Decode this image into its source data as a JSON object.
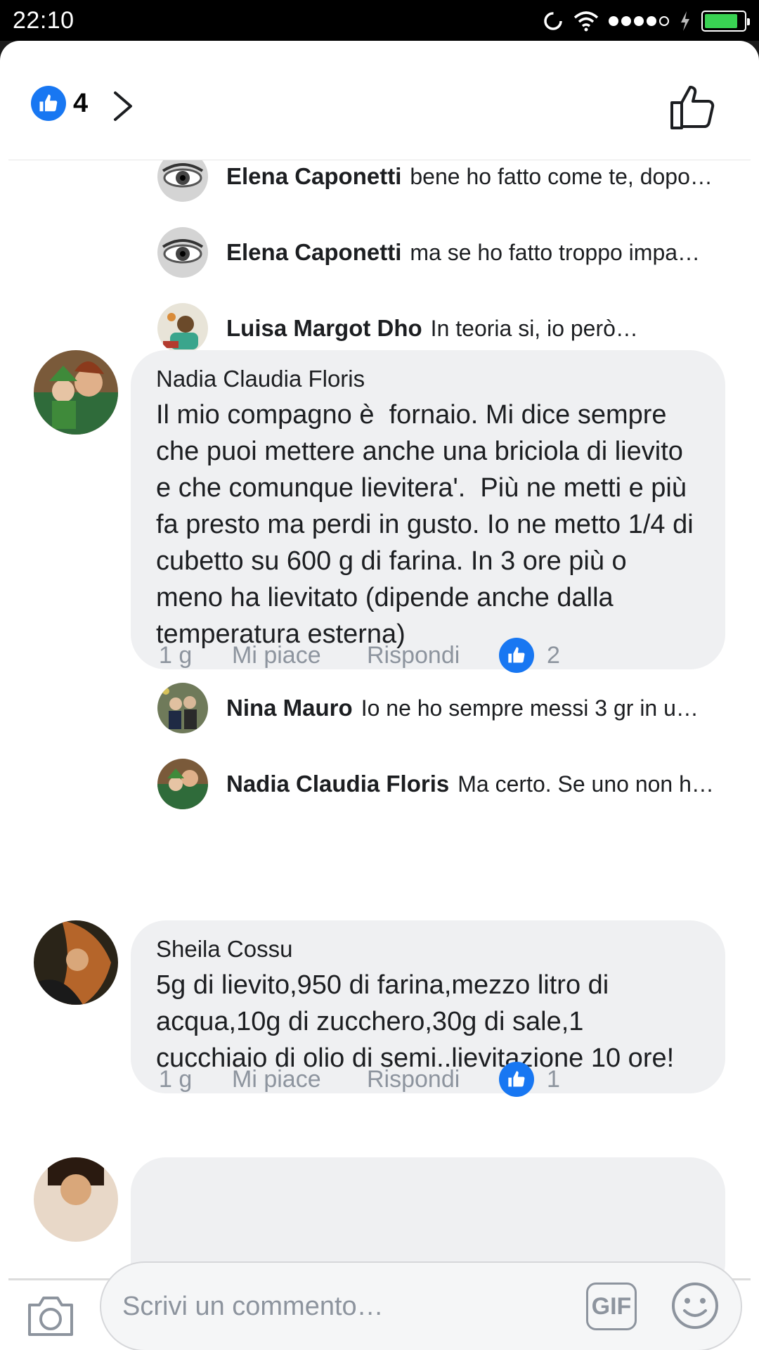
{
  "status_bar": {
    "time": "22:10",
    "battery_level": 0.85,
    "battery_color": "#39d353"
  },
  "header": {
    "reaction_count": "4",
    "accent": "#1877f2"
  },
  "replies_top": [
    {
      "author": "Elena Caponetti",
      "text": "bene ho fatto come te, dopo…"
    },
    {
      "author": "Elena Caponetti",
      "text": "ma se ho fatto troppo impa…"
    },
    {
      "author": "Luisa Margot Dho",
      "text": "In teoria si, io però…"
    }
  ],
  "comment1": {
    "author": "Nadia Claudia Floris",
    "text": "Il mio compagno è  fornaio. Mi dice sempre che puoi mettere anche una briciola di lievito e che comunque lievitera'.  Più ne metti e più fa presto ma perdi in gusto. Io ne metto 1/4 di cubetto su 600 g di farina. In 3 ore più o meno ha lievitato (dipende anche dalla temperatura esterna)",
    "time": "1 g",
    "like_label": "Mi piace",
    "reply_label": "Rispondi",
    "like_count": "2"
  },
  "replies_mid": [
    {
      "author": "Nina Mauro",
      "text": "Io ne ho sempre messi 3 gr in u…"
    },
    {
      "author": "Nadia Claudia Floris",
      "text": "Ma certo. Se uno non h…"
    }
  ],
  "comment2": {
    "author": "Sheila Cossu",
    "text": "5g di lievito,950 di farina,mezzo litro di acqua,10g di zucchero,30g di sale,1 cucchiaio di olio di semi..lievitazione 10 ore!",
    "time": "1 g",
    "like_label": "Mi piace",
    "reply_label": "Rispondi",
    "like_count": "1"
  },
  "composer": {
    "placeholder": "Scrivi un commento…",
    "gif_label": "GIF"
  },
  "icons": [
    "like-icon",
    "chevron-right-icon",
    "thumbs-up-outline-icon",
    "camera-icon",
    "smiley-icon",
    "wifi-icon",
    "sync-icon",
    "charging-icon"
  ]
}
